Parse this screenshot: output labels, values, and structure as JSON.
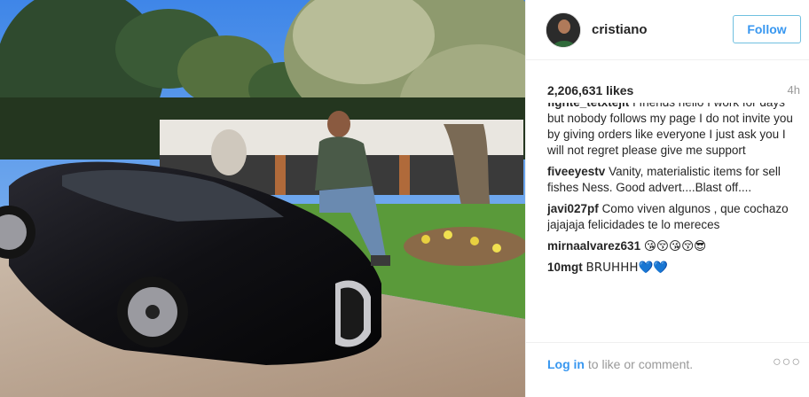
{
  "post": {
    "username": "cristiano",
    "follow_label": "Follow",
    "likes": "2,206,631 likes",
    "time": "4h"
  },
  "comments": [
    {
      "user": "fighte_tetxtejit",
      "text": "I friends hello I work for days but nobody follows my page I do not invite you by giving orders like everyone I just ask you I will not regret please give me support"
    },
    {
      "user": "fiveeyestv",
      "text": "Vanity, materialistic items for sell fishes Ness. Good advert....Blast off...."
    },
    {
      "user": "javi027pf",
      "text": "Como viven algunos , que cochazo jajajaja felicidades te lo mereces"
    },
    {
      "user": "mirnaalvarez631",
      "text": "😘😚😘😚😎"
    },
    {
      "user": "10mgt",
      "text": "BRUHHH💙💙"
    }
  ],
  "footer": {
    "login_link": "Log in",
    "login_rest": " to like or comment.",
    "more_label": "○○○"
  },
  "icons": {
    "more": "ellipsis-icon"
  }
}
